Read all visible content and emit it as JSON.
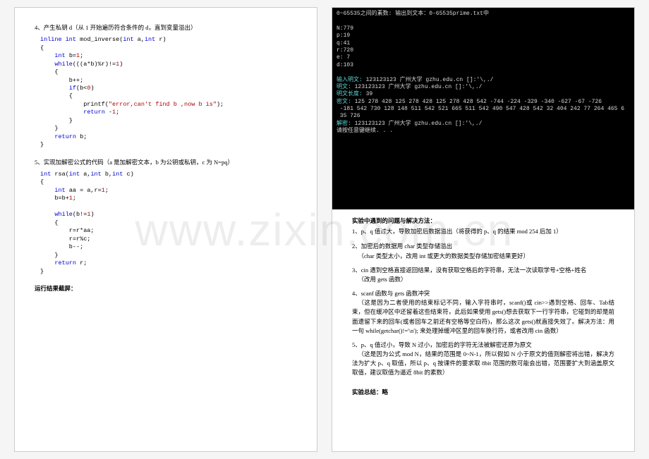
{
  "watermark": "www.zixin.com.cn",
  "left": {
    "sec4_title": "4、产生私钥 d（从 1 开始遍历符合条件的 d，直到变量溢出）",
    "code4_l1": "inline int mod_inverse(int a,int r)",
    "code4_l2": "{",
    "code4_l3": "    int b=1;",
    "code4_l4": "    while(((a*b)%r)!=1)",
    "code4_l5": "    {",
    "code4_l6": "        b++;",
    "code4_l7": "        if(b<0)",
    "code4_l8": "        {",
    "code4_l9": "            printf(\"error,can't find b ,now b is\");",
    "code4_l10": "            return -1;",
    "code4_l11": "        }",
    "code4_l12": "    }",
    "code4_l13": "    return b;",
    "code4_l14": "}",
    "sec5_title": "5、实现加解密公式的代码（a 是加解密文本，b 为公钥或私钥，c 为 N=pq）",
    "code5_l1": "int rsa(int a,int b,int c)",
    "code5_l2": "{",
    "code5_l3": "    int aa = a,r=1;",
    "code5_l4": "    b=b+1;",
    "code5_l5": "",
    "code5_l6": "    while(b!=1)",
    "code5_l7": "    {",
    "code5_l8": "        r=r*aa;",
    "code5_l9": "        r=r%c;",
    "code5_l10": "        b--;",
    "code5_l11": "    }",
    "code5_l12": "    return r;",
    "code5_l13": "}",
    "run_title": "运行结果截屏："
  },
  "right": {
    "term_l0": "0~65535之间的素数: 输出到文本：0-65535prime.txt中",
    "term_l1": "",
    "term_l2": "N:779",
    "term_l3": "p:19",
    "term_l4": "q:41",
    "term_l5": "r:720",
    "term_l6": "e: 7",
    "term_l7": "d:103",
    "term_l8": "",
    "term_l9a": "输入明文: ",
    "term_l9b": "123123123 广州大学 gzhu.edu.cn []:'\\,./",
    "term_l10a": "明文: ",
    "term_l10b": "123123123 广州大学 gzhu.edu.cn []:'\\,./",
    "term_l11a": "明文长度: ",
    "term_l11b": "39",
    "term_l12a": "密文: ",
    "term_l12b": "125 278 428 125 278 428 125 278 428 542 -744 -224 -329 -340 -627 -67 -726",
    "term_l13": " -181 542 730 128 148 511 542 521 665 511 542 490 547 428 542 32 404 242 77 264 465 6",
    "term_l14": " 35 726",
    "term_l15a": "解密: ",
    "term_l15b": "123123123 广州大学 gzhu.edu.cn []:'\\,./",
    "term_l16": "请按任意键继续. . .",
    "issues_title": "实验中遇到的问题与解决方法：",
    "i1": "1、p、q 值过大，导致加密后数据溢出（将获得的 p、q 的结果 mod 254 后加 1）",
    "i2a": "2、加密后的数据用 char 类型存储溢出",
    "i2b": "（char 类型太小，改用 int 或更大的数据类型存储加密结果更好）",
    "i3a": "3、cin 遇到空格直接返回结果，没有获取空格后的字符串，无法一次读取学号+空格+姓名",
    "i3b": "（改用 gets 函数）",
    "i4a": "4、scanf 函数与 gets 函数冲突",
    "i4b": "（这是因为二者使用的结束标记不同，输入字符串时，scanf()或 cin>>遇到空格、回车、Tab结束，但在缓冲区中还留着这些结束符，此后如果使用 gets()想去获取下一行字符串，它碰到的却是前面遗留下来的回车(或者回车之前还有空格等空白符)，那么这次 gets()就直接失效了。解决方法：用一句 while(getchar()!='\\n');  来处理掉缓冲区里的回车换行符，或者改用 cin 函数）",
    "i5a": "5、p、q 值过小，导致 N 过小，加密后的字符无法被解密还原为原文",
    "i5b": "（这是因为公式 mod N，结果的范围是 0~N-1，所以假如 N 小于原文的值则解密将出错，解决方法为扩大 p、q 取值，所以 p、q 按课件的要求取 8bit 范围的数可能会出错，范围要扩大到涵盖原文取值，建议取值为逼近 8bit 的素数）",
    "summary": "实验总结：略"
  }
}
